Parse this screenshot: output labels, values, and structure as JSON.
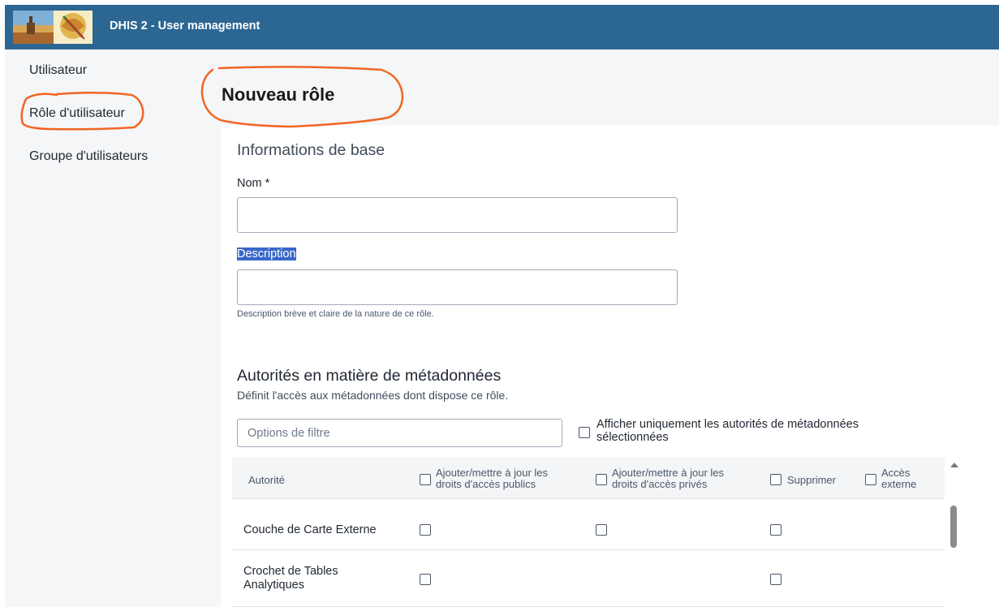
{
  "header": {
    "app_title": "DHIS 2 - User management"
  },
  "sidebar": {
    "items": [
      {
        "label": "Utilisateur"
      },
      {
        "label": "Rôle d'utilisateur"
      },
      {
        "label": "Groupe d'utilisateurs"
      }
    ]
  },
  "page": {
    "title": "Nouveau rôle"
  },
  "basic_info": {
    "heading": "Informations de base",
    "name_label": "Nom *",
    "name_value": "",
    "description_label": "Description",
    "description_value": "",
    "description_help": "Description brève et claire de la nature de ce rôle."
  },
  "metadata": {
    "heading": "Autorités en matière de métadonnées",
    "subheading": "Définit l'accès aux métadonnées dont dispose ce rôle.",
    "filter_placeholder": "Options de filtre",
    "show_selected_label": "Afficher uniquement les autorités de métadonnées sélectionnées",
    "columns": {
      "authority": "Autorité",
      "add_public": "Ajouter/mettre à jour les droits d'accès publics",
      "add_private": "Ajouter/mettre à jour les droits d'accès privés",
      "delete": "Supprimer",
      "external": "Accès externe"
    },
    "rows": [
      {
        "name": "Couche de Carte Externe",
        "public": false,
        "private": false,
        "delete": false
      },
      {
        "name": "Crochet de Tables Analytiques",
        "public": false,
        "delete": false
      }
    ]
  },
  "colors": {
    "header_bg": "#2c6693",
    "annotation": "#f26522",
    "selection": "#3a68c9"
  }
}
